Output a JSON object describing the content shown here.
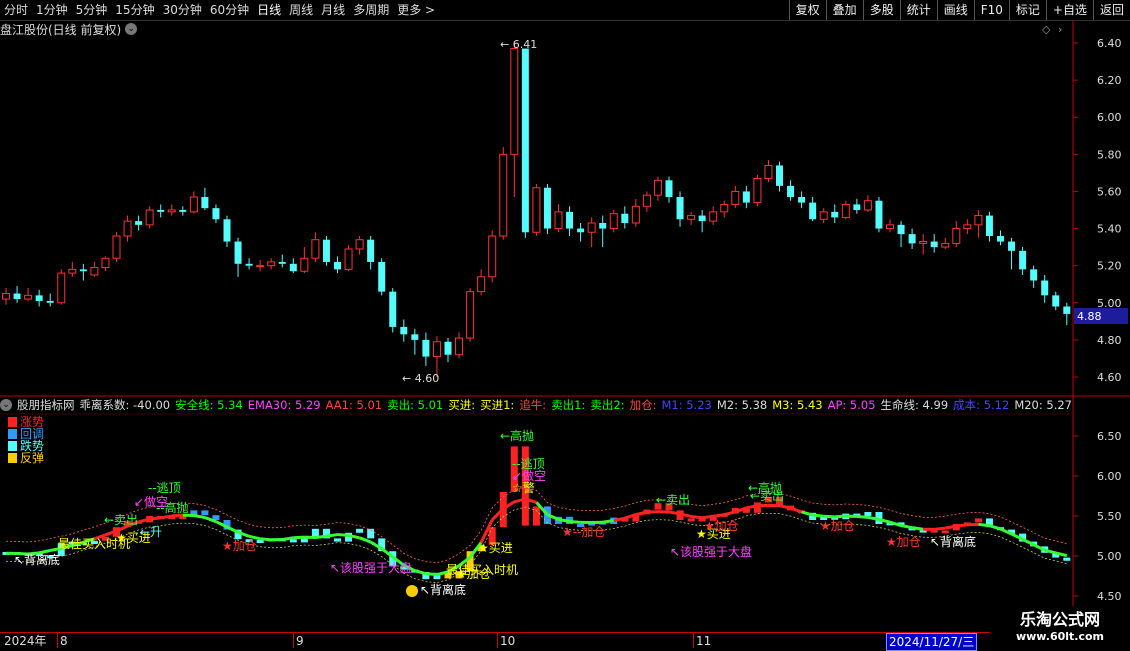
{
  "toolbar": {
    "tabs": [
      "分时",
      "1分钟",
      "5分钟",
      "15分钟",
      "30分钟",
      "60分钟",
      "日线",
      "周线",
      "月线",
      "多周期",
      "更多 >"
    ],
    "active_tab": "日线",
    "right_buttons": [
      "复权",
      "叠加",
      "多股",
      "统计",
      "画线",
      "F10",
      "标记",
      "+自选",
      "返回"
    ]
  },
  "main_chart": {
    "title": "盘江股份(日线 前复权)",
    "price_axis": [
      "6.40",
      "6.20",
      "6.00",
      "5.80",
      "5.60",
      "5.40",
      "5.20",
      "5.00",
      "4.80",
      "4.60"
    ],
    "current_price": "4.88",
    "high_label": "6.41",
    "low_label": "4.60",
    "colors": {
      "up": "#ff3232",
      "down": "#54fcfc",
      "axis": "#c00000"
    }
  },
  "indicator": {
    "name": "股朋指标网",
    "items": [
      {
        "label": "乖离系数:",
        "value": "-40.00",
        "color": "#dddddd"
      },
      {
        "label": "安全线:",
        "value": "5.34",
        "color": "#00ff00"
      },
      {
        "label": "EMA30:",
        "value": "5.29",
        "color": "#ff44ff"
      },
      {
        "label": "AA1:",
        "value": "5.01",
        "color": "#ff4444"
      },
      {
        "label": "卖出:",
        "value": "5.01",
        "color": "#00ff00"
      },
      {
        "label": "买进:",
        "value": "",
        "color": "#ffff00"
      },
      {
        "label": "买进1:",
        "value": "",
        "color": "#ffff00"
      },
      {
        "label": "追牛:",
        "value": "",
        "color": "#ff4444"
      },
      {
        "label": "卖出1:",
        "value": "",
        "color": "#00ff00"
      },
      {
        "label": "卖出2:",
        "value": "",
        "color": "#00ff00"
      },
      {
        "label": "加仓:",
        "value": "",
        "color": "#ff4444"
      },
      {
        "label": "M1:",
        "value": "5.23",
        "color": "#4444ff"
      },
      {
        "label": "M2:",
        "value": "5.38",
        "color": "#dddddd"
      },
      {
        "label": "M3:",
        "value": "5.43",
        "color": "#ffff00"
      },
      {
        "label": "AP:",
        "value": "5.05",
        "color": "#ff44ff"
      },
      {
        "label": "生命线:",
        "value": "4.99",
        "color": "#dddddd"
      },
      {
        "label": "成本:",
        "value": "5.12",
        "color": "#4444ff"
      },
      {
        "label": "M20:",
        "value": "5.27",
        "color": "#dddddd"
      }
    ],
    "legend": [
      {
        "label": "涨势",
        "color": "#ff2222"
      },
      {
        "label": "回调",
        "color": "#3399ff"
      },
      {
        "label": "跌势",
        "color": "#54fcfc"
      },
      {
        "label": "反弹",
        "color": "#ffcc00"
      }
    ],
    "axis": [
      "6.50",
      "6.00",
      "5.50",
      "5.00",
      "4.50"
    ],
    "annotations": {
      "high_throw": "高抛",
      "escape_top": "逃顶",
      "short": "做空",
      "sell": "卖出",
      "buy": "买进",
      "add": "加仓",
      "divergence_bottom": "背离底",
      "best_buy": "最佳买入时机",
      "stronger": "该股强于大盘",
      "warning": "警",
      "rise": "升"
    }
  },
  "dates": {
    "year": "2024年",
    "months": [
      "8",
      "9",
      "10",
      "11"
    ],
    "cursor": "2024/11/27/三"
  },
  "watermark": {
    "title": "乐淘公式网",
    "url": "www.60lt.com"
  }
}
